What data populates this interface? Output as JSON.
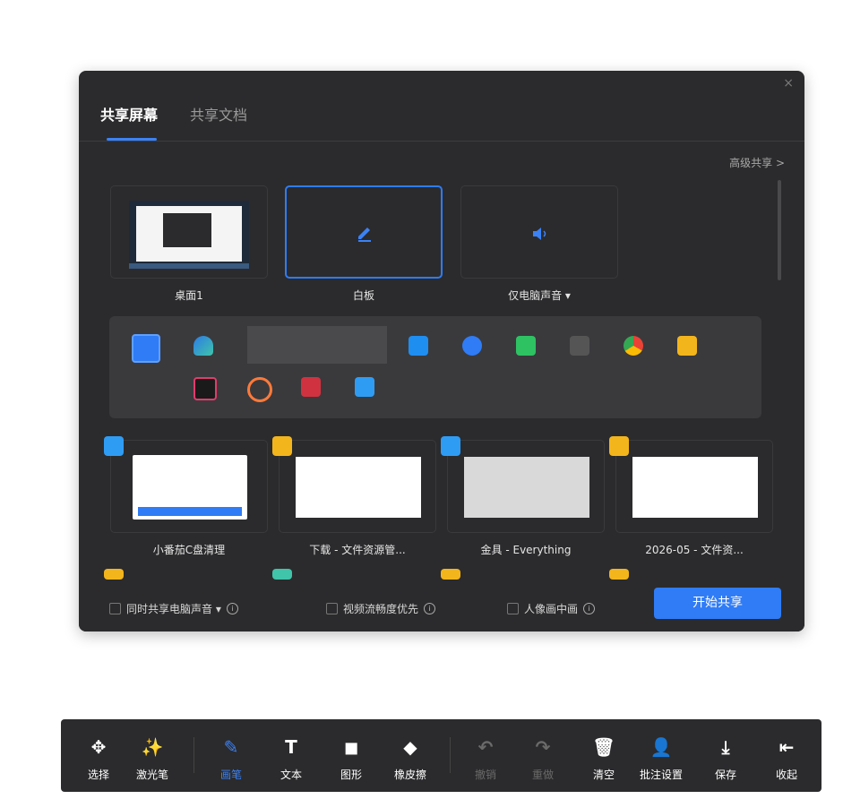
{
  "dialog": {
    "close_glyph": "×",
    "tabs": [
      "共享屏幕",
      "共享文档"
    ],
    "advanced_share": "高级共享 >",
    "sources": [
      {
        "label": "桌面1"
      },
      {
        "label": "白板"
      },
      {
        "label": "仅电脑声音 ▾"
      }
    ],
    "windows": [
      {
        "label": "小番茄C盘清理"
      },
      {
        "label": "下载 - 文件资源管..."
      },
      {
        "label": "金具 - Everything"
      },
      {
        "label": "2026-05 - 文件资..."
      }
    ],
    "options": [
      {
        "label": "同时共享电脑声音 ▾"
      },
      {
        "label": "视频流畅度优先"
      },
      {
        "label": "人像画中画"
      }
    ],
    "start_button": "开始共享"
  },
  "toolbar": [
    {
      "label": "选择",
      "icon": "move-icon",
      "glyph": "✥"
    },
    {
      "label": "激光笔",
      "icon": "laser-pointer-icon",
      "glyph": "✨"
    },
    {
      "label": "画笔",
      "icon": "pen-icon",
      "glyph": "✎"
    },
    {
      "label": "文本",
      "icon": "text-icon",
      "glyph": "T"
    },
    {
      "label": "图形",
      "icon": "shapes-icon",
      "glyph": "◼"
    },
    {
      "label": "橡皮擦",
      "icon": "eraser-icon",
      "glyph": "◆"
    },
    {
      "label": "撤销",
      "icon": "undo-icon",
      "glyph": "↶"
    },
    {
      "label": "重做",
      "icon": "redo-icon",
      "glyph": "↷"
    },
    {
      "label": "清空",
      "icon": "trash-icon",
      "glyph": "🗑"
    },
    {
      "label": "批注设置",
      "icon": "user-settings-icon",
      "glyph": "👤"
    },
    {
      "label": "保存",
      "icon": "download-icon",
      "glyph": "⤓"
    },
    {
      "label": "收起",
      "icon": "collapse-icon",
      "glyph": "⇤"
    }
  ],
  "colors": {
    "accent": "#2f7cf6",
    "panel": "#2b2b2d",
    "app_strip": "#3a3a3d"
  }
}
